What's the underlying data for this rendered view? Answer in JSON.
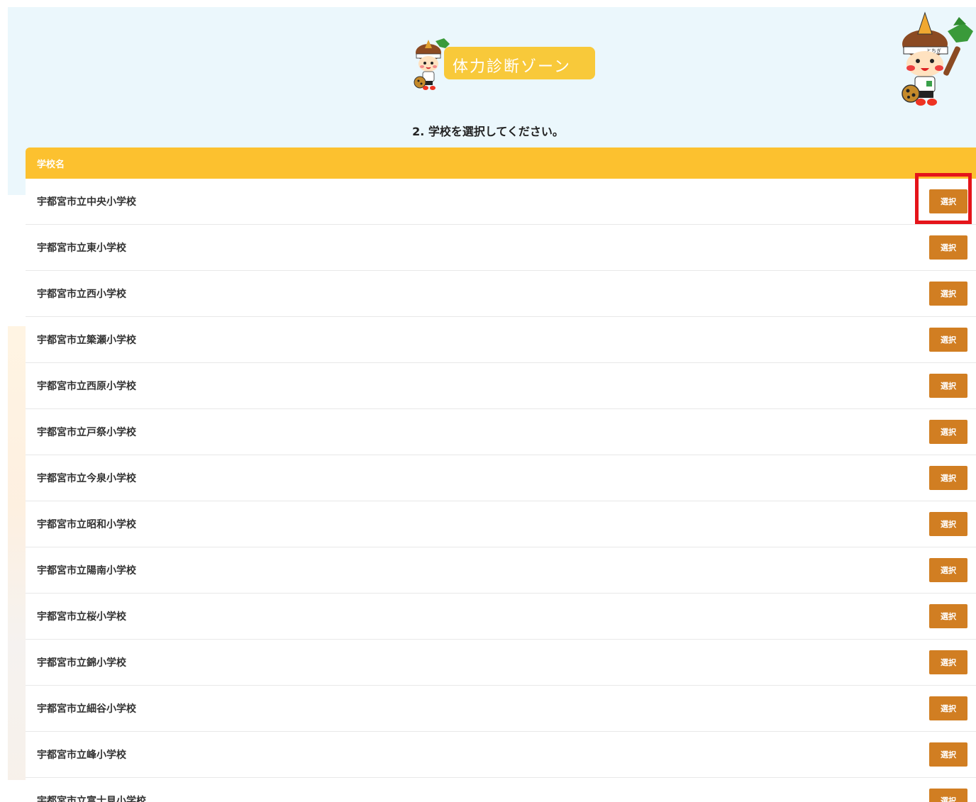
{
  "header": {
    "logo_title": "体力診断ゾーン",
    "instruction": "2. 学校を選択してください。"
  },
  "table": {
    "column_header": "学校名",
    "button_label": "選択",
    "schools": [
      "宇都宮市立中央小学校",
      "宇都宮市立東小学校",
      "宇都宮市立西小学校",
      "宇都宮市立簗瀬小学校",
      "宇都宮市立西原小学校",
      "宇都宮市立戸祭小学校",
      "宇都宮市立今泉小学校",
      "宇都宮市立昭和小学校",
      "宇都宮市立陽南小学校",
      "宇都宮市立桜小学校",
      "宇都宮市立錦小学校",
      "宇都宮市立細谷小学校",
      "宇都宮市立峰小学校",
      "宇都宮市立富士見小学校"
    ]
  },
  "colors": {
    "hero_bg": "#ebf7fc",
    "table_header": "#fcc12f",
    "button": "#d17e22",
    "highlight": "#e5141a"
  },
  "icons": {
    "mascot": "tochigi-mascot-illustration"
  }
}
